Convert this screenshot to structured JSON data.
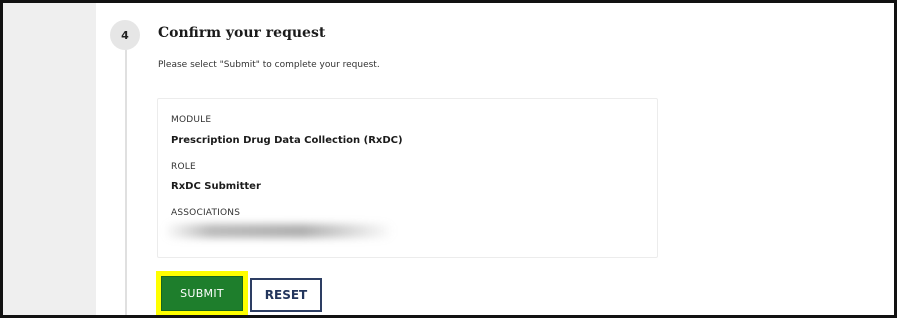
{
  "step": {
    "number": "4",
    "title": "Confirm your request",
    "instructions": "Please select \"Submit\" to complete your request."
  },
  "summary": {
    "module_label": "MODULE",
    "module_value": "Prescription Drug Data Collection (RxDC)",
    "role_label": "ROLE",
    "role_value": "RxDC Submitter",
    "associations_label": "ASSOCIATIONS"
  },
  "actions": {
    "submit_label": "SUBMIT",
    "reset_label": "RESET"
  },
  "colors": {
    "submit_bg": "#1e7e2c",
    "highlight": "#ffff00",
    "reset_border": "#2d3e63"
  }
}
